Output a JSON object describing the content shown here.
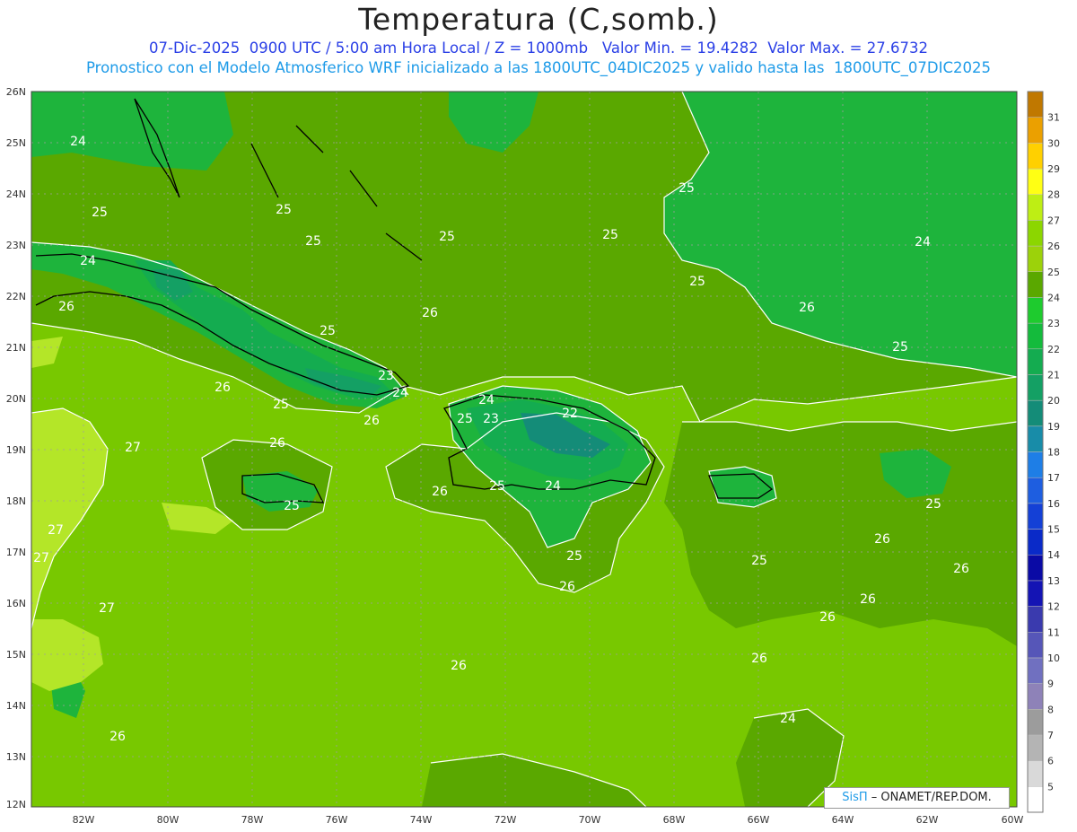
{
  "title": "Temperatura (C,somb.)",
  "subtitle_1": "07-Dic-2025  0900 UTC / 5:00 am Hora Local / Z = 1000mb   Valor Min. = 19.4282  Valor Max. = 27.6732",
  "subtitle_2": "Pronostico con el Modelo Atmosferico WRF inicializado a las 1800UTC_04DIC2025 y valido hasta las  1800UTC_07DIC2025",
  "credit": {
    "brand": "SisΠ",
    "text": " – ONAMET/REP.DOM."
  },
  "axes": {
    "lon_labels": [
      "82W",
      "80W",
      "78W",
      "76W",
      "74W",
      "72W",
      "70W",
      "68W",
      "66W",
      "64W",
      "62W",
      "60W"
    ],
    "lat_labels": [
      "26N",
      "25N",
      "24N",
      "23N",
      "22N",
      "21N",
      "20N",
      "19N",
      "18N",
      "17N",
      "16N",
      "15N",
      "14N",
      "13N",
      "12N"
    ]
  },
  "colorbar": {
    "labels": [
      "5",
      "6",
      "7",
      "8",
      "9",
      "10",
      "11",
      "12",
      "13",
      "14",
      "15",
      "16",
      "17",
      "18",
      "19",
      "20",
      "21",
      "22",
      "23",
      "24",
      "25",
      "26",
      "27",
      "28",
      "29",
      "30",
      "31"
    ],
    "colors": [
      "#ffffff",
      "#d9d9d9",
      "#b4b4b4",
      "#9c9c9c",
      "#8e82b8",
      "#7070c0",
      "#5656b8",
      "#3a3aae",
      "#1414b4",
      "#0a0aa5",
      "#0a2ac8",
      "#1440d6",
      "#1e5ee0",
      "#1e7ee6",
      "#188ca8",
      "#148c78",
      "#14a064",
      "#14ac50",
      "#14bb3c",
      "#1ecb2e",
      "#5aa800",
      "#9cd20a",
      "#8cd600",
      "#beee14",
      "#ffff14",
      "#ffd000",
      "#eba000",
      "#c07800"
    ]
  },
  "contour_labels": [
    "24",
    "25",
    "25",
    "25",
    "25",
    "25",
    "25",
    "25",
    "24",
    "24",
    "26",
    "26",
    "25",
    "23",
    "24",
    "26",
    "25",
    "26",
    "26",
    "27",
    "24",
    "25",
    "23",
    "22",
    "25",
    "26",
    "26",
    "25",
    "25",
    "24",
    "25",
    "25",
    "26",
    "27",
    "27",
    "27",
    "26",
    "26",
    "25",
    "26",
    "26",
    "26",
    "26",
    "26",
    "24"
  ],
  "palette": {
    "c24": "#1eb43c",
    "c25": "#5aa800",
    "c26": "#78c800",
    "c27": "#b4e628"
  }
}
